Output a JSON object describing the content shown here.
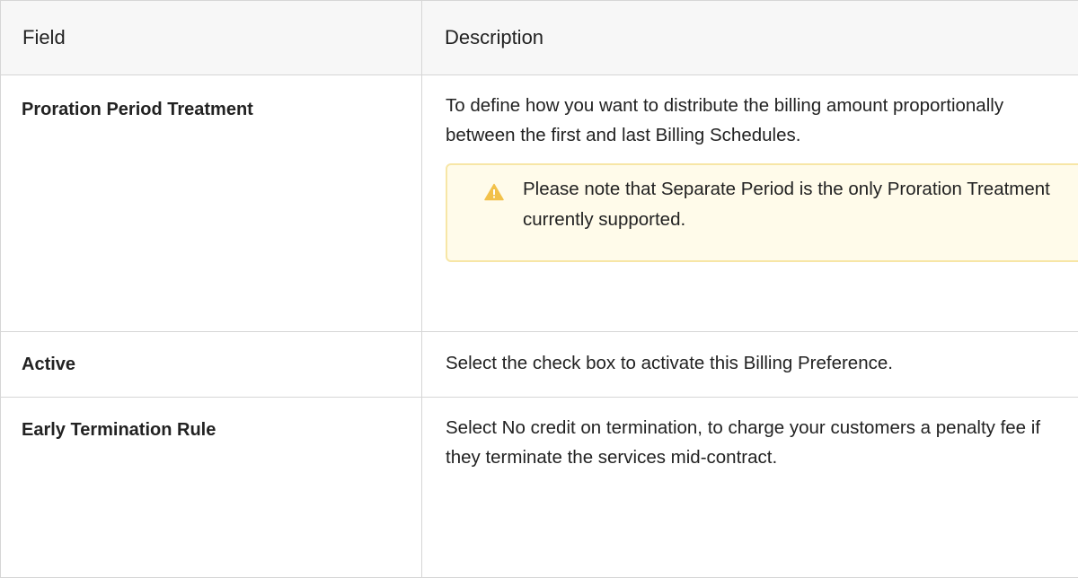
{
  "table": {
    "headers": {
      "field": "Field",
      "description": "Description"
    },
    "rows": [
      {
        "field": "Proration Period Treatment",
        "description": "To define how you want to distribute the billing amount proportionally between the first and last Billing Schedules.",
        "note": "Please note that Separate Period is the only Proration Treatment currently supported."
      },
      {
        "field": "Active",
        "description": "Select the check box to activate this Billing Preference."
      },
      {
        "field": "Early Termination Rule",
        "description": "Select No credit on termination, to charge your customers a penalty fee if they terminate the services mid-contract."
      }
    ]
  },
  "icons": {
    "note_icon": "warning-icon"
  },
  "colors": {
    "warning": "#f2c14a",
    "note_background": "#fffbea",
    "note_border": "#f7e6a6"
  }
}
